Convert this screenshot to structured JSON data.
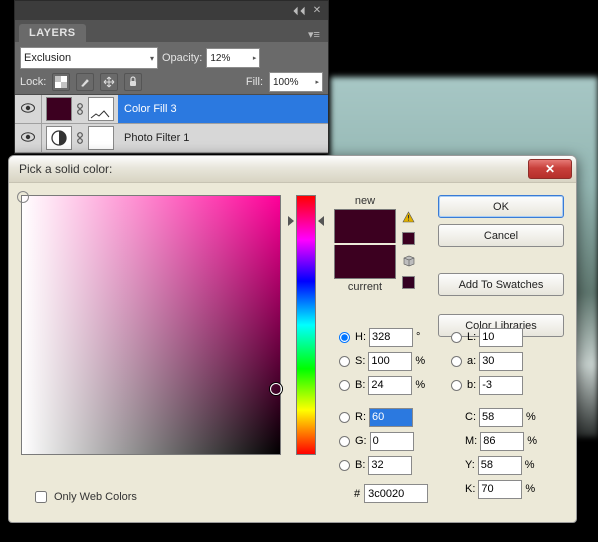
{
  "layers_panel": {
    "tab_label": "LAYERS",
    "blend_mode": "Exclusion",
    "opacity_label": "Opacity:",
    "opacity_value": "12%",
    "lock_label": "Lock:",
    "fill_label": "Fill:",
    "fill_value": "100%",
    "layers": [
      {
        "name": "Color Fill 3",
        "selected": true,
        "thumb_color": "#3c0020",
        "has_mask": true,
        "mask_preview": "vector"
      },
      {
        "name": "Photo Filter 1",
        "selected": false,
        "thumb_color": "#e8e8e8",
        "has_mask": true,
        "mask_preview": "white"
      }
    ]
  },
  "color_picker": {
    "title": "Pick a solid color:",
    "labels": {
      "new": "new",
      "current": "current"
    },
    "buttons": {
      "ok": "OK",
      "cancel": "Cancel",
      "add_swatches": "Add To Swatches",
      "color_libraries": "Color Libraries"
    },
    "values": {
      "H": "328",
      "H_unit": "°",
      "S": "100",
      "S_unit": "%",
      "B": "24",
      "B_unit": "%",
      "R": "60",
      "G": "0",
      "B2": "32",
      "L": "10",
      "a": "30",
      "b": "-3",
      "C": "58",
      "M": "86",
      "Y": "58",
      "K": "70",
      "hex": "3c0020"
    },
    "field_labels": {
      "H": "H:",
      "S": "S:",
      "B": "B:",
      "R": "R:",
      "G": "G:",
      "B2": "B:",
      "L": "L:",
      "a": "a:",
      "b": "b:",
      "C": "C:",
      "M": "M:",
      "Y": "Y:",
      "K": "K:",
      "hex": "#"
    },
    "selected_radio": "H",
    "only_web_colors_label": "Only Web Colors",
    "preview_color": "#3c0020",
    "hue_pointer_pct": 8
  }
}
